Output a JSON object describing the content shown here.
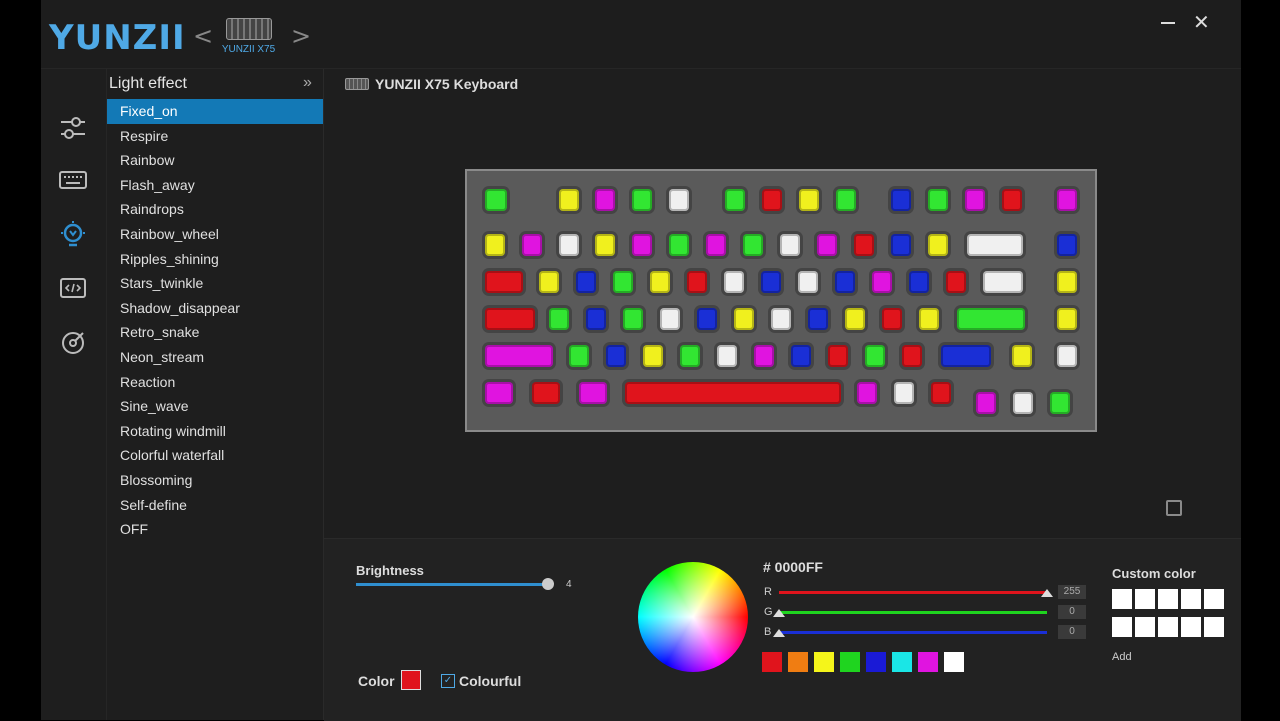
{
  "app": {
    "logo": "YUNZII",
    "device_name": "YUNZII X75",
    "prev_arrow": "<",
    "next_arrow": ">",
    "close": "✕"
  },
  "rail": {
    "icons": [
      "sliders-icon",
      "keyboard-icon",
      "lightbulb-icon",
      "code-icon",
      "macro-icon"
    ],
    "active": "lightbulb-icon"
  },
  "effects": {
    "title": "Light effect",
    "collapse": "»",
    "items": [
      "Fixed_on",
      "Respire",
      "Rainbow",
      "Flash_away",
      "Raindrops",
      "Rainbow_wheel",
      "Ripples_shining",
      "Stars_twinkle",
      "Shadow_disappear",
      "Retro_snake",
      "Neon_stream",
      "Reaction",
      "Sine_wave",
      "Rotating windmill",
      "Colorful waterfall",
      "Blossoming",
      "Self-define",
      "OFF"
    ],
    "selected": "Fixed_on"
  },
  "preview": {
    "title": "YUNZII X75 Keyboard"
  },
  "brightness": {
    "label": "Brightness",
    "value": "4",
    "level": 1.0
  },
  "color": {
    "label": "Color",
    "swatch": "#e0141c",
    "colourful_label": "Colourful",
    "colourful_checked": true
  },
  "picker": {
    "hex": "# 0000FF",
    "r": {
      "label": "R",
      "value": "255",
      "level": 1.0,
      "color": "#e0141c"
    },
    "g": {
      "label": "G",
      "value": "0",
      "level": 0.0,
      "color": "#1fd41f"
    },
    "b": {
      "label": "B",
      "value": "0",
      "level": 0.0,
      "color": "#1a2fd6"
    },
    "presets": [
      "#e0141c",
      "#f07d12",
      "#f5f51a",
      "#1fd41f",
      "#1a1ad6",
      "#1ae6e6",
      "#e014e0",
      "#ffffff"
    ]
  },
  "custom": {
    "title": "Custom color",
    "add_label": "Add",
    "slots": 10
  },
  "colors": {
    "accent": "#1379b6",
    "red": "#e0141c",
    "green": "#32e632",
    "yellow": "#f0f01e",
    "magenta": "#e014e0",
    "blue": "#1a2fd6",
    "white": "#f0f0f0"
  }
}
